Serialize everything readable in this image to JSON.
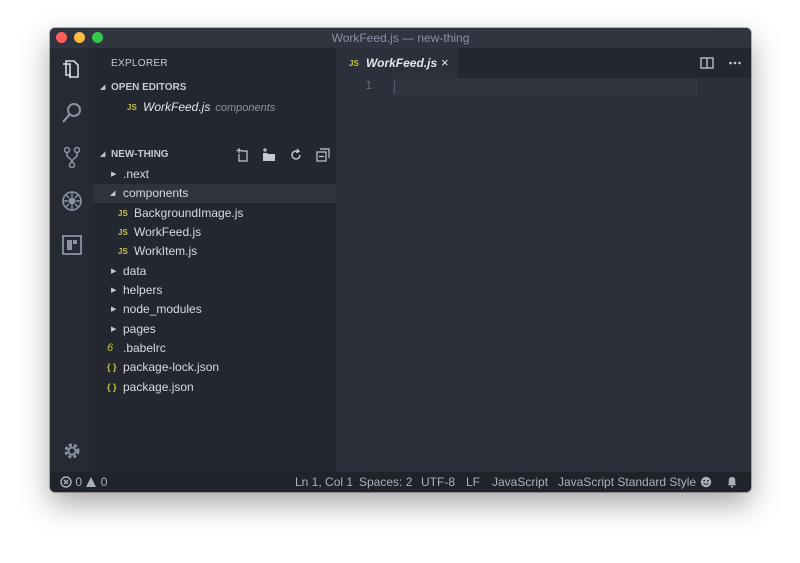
{
  "window": {
    "title": "WorkFeed.js — new-thing",
    "bg": "#2b303b",
    "accent_js": "#c5c04a"
  },
  "activity_bar": {
    "icons": [
      "files-icon",
      "search-icon",
      "source-control-icon",
      "debug-icon",
      "extensions-icon",
      "settings-gear-icon"
    ]
  },
  "sidebar": {
    "header": "EXPLORER",
    "open_editors": {
      "title": "OPEN EDITORS",
      "items": [
        {
          "icon": "JS",
          "name": "WorkFeed.js",
          "description": "components"
        }
      ]
    },
    "project": {
      "title": "NEW-THING",
      "actions": [
        "new-file-icon",
        "new-folder-icon",
        "refresh-icon",
        "collapse-all-icon"
      ],
      "tree": [
        {
          "type": "folder",
          "name": ".next",
          "expanded": false
        },
        {
          "type": "folder",
          "name": "components",
          "expanded": true
        },
        {
          "type": "file",
          "icon": "JS",
          "name": "BackgroundImage.js"
        },
        {
          "type": "file",
          "icon": "JS",
          "name": "WorkFeed.js"
        },
        {
          "type": "file",
          "icon": "JS",
          "name": "WorkItem.js"
        },
        {
          "type": "folder",
          "name": "data",
          "expanded": false
        },
        {
          "type": "folder",
          "name": "helpers",
          "expanded": false
        },
        {
          "type": "folder",
          "name": "node_modules",
          "expanded": false
        },
        {
          "type": "folder",
          "name": "pages",
          "expanded": false
        },
        {
          "type": "file",
          "icon": "babel",
          "name": ".babelrc"
        },
        {
          "type": "file",
          "icon": "{ }",
          "name": "package-lock.json"
        },
        {
          "type": "file",
          "icon": "{ }",
          "name": "package.json"
        }
      ]
    }
  },
  "editor": {
    "tab": {
      "icon": "JS",
      "name": "WorkFeed.js",
      "close": "×"
    },
    "line_numbers": [
      "1"
    ]
  },
  "status_bar": {
    "errors": "0",
    "warnings": "0",
    "position": "Ln 1, Col 1",
    "spaces": "Spaces: 2",
    "encoding": "UTF-8",
    "eol": "LF",
    "language": "JavaScript",
    "linter": "JavaScript Standard Style"
  }
}
